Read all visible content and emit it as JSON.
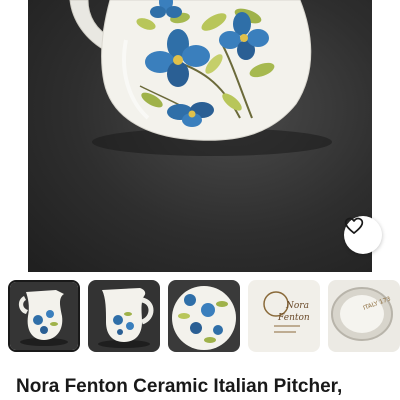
{
  "listing": {
    "title": "Nora Fenton Ceramic Italian Pitcher,",
    "thumbnail_count": 5,
    "selected_thumbnail": 1
  },
  "stamp": {
    "line1": "Nora",
    "line2": "Fenton",
    "mark": "ITALY 173"
  },
  "icons": {
    "favorite": "heart-outline-icon"
  },
  "colors": {
    "backdrop": "#2e2e2e",
    "ceramic": "#f3f2ec",
    "flower_blue": "#2f6fa8",
    "leaf_green": "#9fb24a",
    "text": "#191919"
  }
}
